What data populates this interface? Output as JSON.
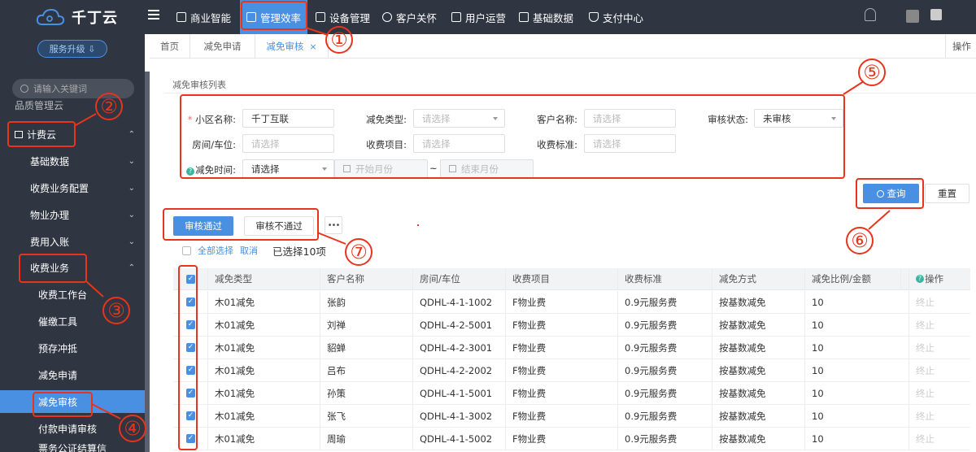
{
  "brand": {
    "name": "千丁云",
    "upgrade": "服务升级 ⇩"
  },
  "sidebar": {
    "search_placeholder": "请输入关键词",
    "items": [
      {
        "label": "品质管理云",
        "caret": ""
      },
      {
        "label": "计费云",
        "caret": "⌃"
      },
      {
        "label": "基础数据",
        "caret": "⌄"
      },
      {
        "label": "收费业务配置",
        "caret": "⌄"
      },
      {
        "label": "物业办理",
        "caret": "⌄"
      },
      {
        "label": "费用入账",
        "caret": "⌄"
      },
      {
        "label": "收费业务",
        "caret": "⌃"
      },
      {
        "label": "收费工作台"
      },
      {
        "label": "催缴工具"
      },
      {
        "label": "预存冲抵"
      },
      {
        "label": "减免申请"
      },
      {
        "label": "减免审核"
      },
      {
        "label": "付款申请审核"
      },
      {
        "label": "票务公证结算信"
      }
    ]
  },
  "topnav": [
    {
      "label": "商业智能",
      "icon": "chart-bar-icon"
    },
    {
      "label": "管理效率",
      "icon": "line-chart-icon"
    },
    {
      "label": "设备管理",
      "icon": "export-icon"
    },
    {
      "label": "客户关怀",
      "icon": "heart-icon"
    },
    {
      "label": "用户运营",
      "icon": "user-icon"
    },
    {
      "label": "基础数据",
      "icon": "wrench-icon"
    },
    {
      "label": "支付中心",
      "icon": "shield-icon"
    }
  ],
  "tabs": [
    {
      "label": "首页"
    },
    {
      "label": "减免申请"
    },
    {
      "label": "减免审核",
      "close": "×"
    }
  ],
  "ops_tab": "操作",
  "section_title": "减免审核列表",
  "filters": {
    "community_label": "小区名称:",
    "community_value": "千丁互联",
    "type_label": "减免类型:",
    "type_placeholder": "请选择",
    "customer_label": "客户名称:",
    "customer_placeholder": "请选择",
    "status_label": "审核状态:",
    "status_value": "未审核",
    "room_label": "房间/车位:",
    "room_placeholder": "请选择",
    "item_label": "收费项目:",
    "item_placeholder": "请选择",
    "standard_label": "收费标准:",
    "standard_placeholder": "请选择",
    "time_label": "减免时间:",
    "time_value": "请选择",
    "start_placeholder": "开始月份",
    "tilde": "~",
    "end_placeholder": "结束月份",
    "query": "查询",
    "reset": "重置"
  },
  "actions": {
    "approve": "审核通过",
    "reject": "审核不通过",
    "more": "•••",
    "select_all": "全部选择",
    "cancel": "取消",
    "selected": "已选择10项"
  },
  "table": {
    "headers": [
      "减免类型",
      "客户名称",
      "房间/车位",
      "收费项目",
      "收费标准",
      "减免方式",
      "减免比例/金额",
      "",
      "操作"
    ],
    "rows": [
      [
        "木01减免",
        "张韵",
        "QDHL-4-1-1002",
        "F物业费",
        "0.9元服务费",
        "按基数减免",
        "10",
        "终止"
      ],
      [
        "木01减免",
        "刘禅",
        "QDHL-4-2-5001",
        "F物业费",
        "0.9元服务费",
        "按基数减免",
        "10",
        "终止"
      ],
      [
        "木01减免",
        "貂蝉",
        "QDHL-4-2-3001",
        "F物业费",
        "0.9元服务费",
        "按基数减免",
        "10",
        "终止"
      ],
      [
        "木01减免",
        "吕布",
        "QDHL-4-2-2002",
        "F物业费",
        "0.9元服务费",
        "按基数减免",
        "10",
        "终止"
      ],
      [
        "木01减免",
        "孙策",
        "QDHL-4-1-5001",
        "F物业费",
        "0.9元服务费",
        "按基数减免",
        "10",
        "终止"
      ],
      [
        "木01减免",
        "张飞",
        "QDHL-4-1-3002",
        "F物业费",
        "0.9元服务费",
        "按基数减免",
        "10",
        "终止"
      ],
      [
        "木01减免",
        "周瑜",
        "QDHL-4-1-5002",
        "F物业费",
        "0.9元服务费",
        "按基数减免",
        "10",
        "终止"
      ]
    ]
  },
  "annotations": [
    "①",
    "②",
    "③",
    "④",
    "⑤",
    "⑥",
    "⑦"
  ],
  "colors": {
    "sidebar_bg": "#2f3541",
    "accent": "#4a90e2",
    "annotation": "#e8341c"
  }
}
